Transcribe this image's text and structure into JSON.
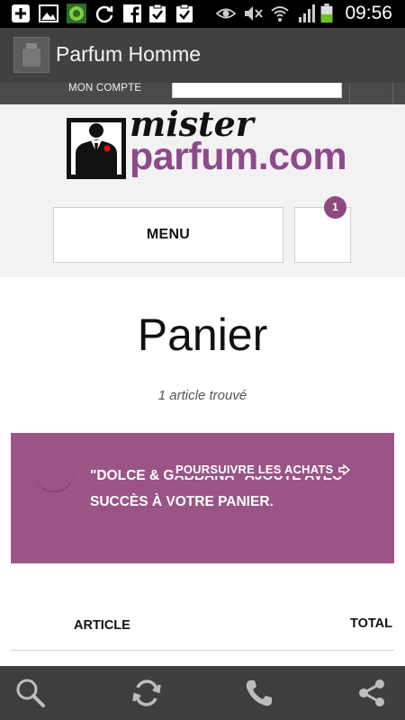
{
  "status_bar": {
    "time": "09:56",
    "icons": [
      "add-icon",
      "image-icon",
      "app-notification-icon",
      "sync-icon",
      "facebook-icon",
      "clipboard-check-icon",
      "clipboard-check-icon",
      "eye-icon",
      "mute-icon",
      "wifi-icon",
      "signal-icon",
      "battery-icon"
    ]
  },
  "app_bar": {
    "title": "Parfum Homme"
  },
  "account_bar": {
    "label": "MON COMPTE"
  },
  "header": {
    "logo_top": "mister",
    "logo_bottom": "parfum.com",
    "menu_label": "MENU",
    "cart_count": "1"
  },
  "content": {
    "title": "Panier",
    "subtitle": "1 article trouvé",
    "notice_message": "\"DOLCE & GABBANA\" AJOUTÉ AVEC SUCCÈS À VOTRE PANIER.",
    "notice_link": "POURSUIVRE LES ACHATS",
    "table_headers": {
      "article": "ARTICLE",
      "total": "TOTAL"
    }
  },
  "bottom_bar": {
    "icons": [
      "search-icon",
      "refresh-icon",
      "phone-icon",
      "share-icon"
    ]
  },
  "colors": {
    "brand": "#8e4a8d",
    "notice_bg": "#9a5485",
    "appbar_bg": "#3f423f",
    "bottombar_bg": "#3d3f3d"
  }
}
